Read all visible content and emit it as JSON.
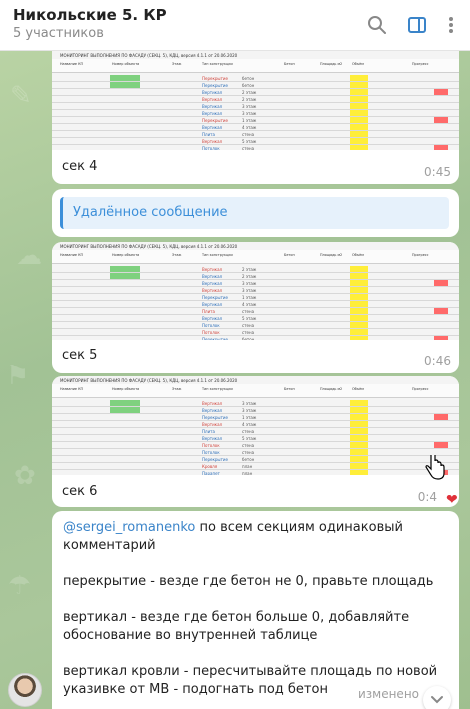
{
  "header": {
    "title": "Никольские 5. КР",
    "subtitle": "5 участников"
  },
  "colors": {
    "accent": "#3a84c9",
    "yellow_cell": "#ffee3a",
    "green_cell": "#7fd17f",
    "red_cell": "#ff6a6a"
  },
  "messages": [
    {
      "caption": "сек 4",
      "time": "0:45"
    },
    {
      "deleted_label": "Удалённое сообщение"
    },
    {
      "caption": "сек 5",
      "time": "0:46"
    },
    {
      "caption": "сек 6",
      "time": "0:4"
    },
    {
      "mention": "@sergei_romanenko",
      "line1": " по всем секциям одинаковый",
      "line2": "комментарий",
      "para2": "перекрытие - везде где бетон не 0, правьте площадь",
      "para3_1": "вертикал  - везде где бетон больше 0, добавляйте",
      "para3_2": "обоснование во внутренней таблице",
      "para4_1": "вертикал кровли - пересчитывайте площадь по новой",
      "para4_2": "указивке от МВ - подогнать под бетон",
      "edited": "изменено"
    }
  ],
  "sheet": {
    "title": "МОНИТОРИНГ ВЫПОЛНЕНИЯ ПО ФАСАДУ (СЕКЦ. 5), КДЦ, версия 4.1.1 от 20.06.2020",
    "headers": [
      "Название КП",
      "Номер объекта",
      "Этаж",
      "Тип конструкции",
      "Бетон",
      "Площадь м2",
      "Объём",
      "Прогресс"
    ],
    "rows": [
      [
        "Перекрытие",
        "бетон"
      ],
      [
        "Перекрытие",
        "бетон"
      ],
      [
        "Вертикал",
        "2 этаж"
      ],
      [
        "Вертикал",
        "2 этаж"
      ],
      [
        "Вертикал",
        "3 этаж"
      ],
      [
        "Вертикал",
        "3 этаж"
      ],
      [
        "Перекрытие",
        "1 этаж"
      ],
      [
        "Вертикал",
        "4 этаж"
      ],
      [
        "Плита",
        "стена"
      ],
      [
        "Вертикал",
        "5 этаж"
      ],
      [
        "Потолок",
        "стена"
      ],
      [
        "Потолок",
        "стена"
      ],
      [
        "Перекрытие",
        "бетон"
      ],
      [
        "Кровля",
        "план"
      ],
      [
        "Парапет",
        "план"
      ],
      [
        "Перекрытие",
        "бетон"
      ]
    ]
  }
}
